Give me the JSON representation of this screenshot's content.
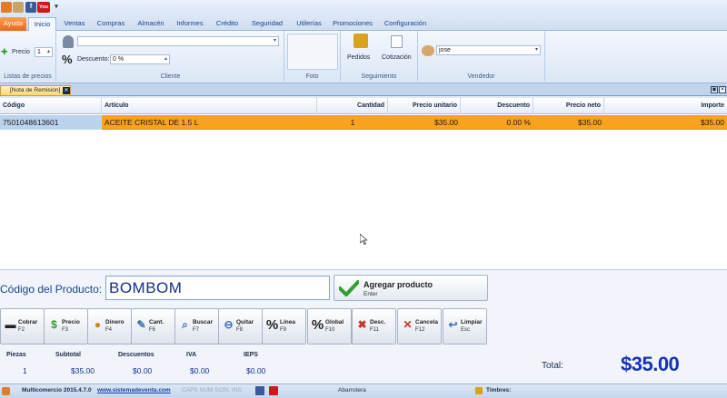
{
  "quick_access": {
    "icons": [
      "app-icon",
      "user-icon",
      "facebook-icon",
      "youtube-icon",
      "dropdown-icon"
    ],
    "facebook_glyph": "f",
    "youtube_glyph": "You",
    "dropdown_glyph": "▾"
  },
  "tabs": [
    "Ayuda",
    "Inicio",
    "Ventas",
    "Compras",
    "Almacén",
    "Informes",
    "Crédito",
    "Seguridad",
    "Utilerías",
    "Promociones",
    "Configuración"
  ],
  "ribbon": {
    "price_list": {
      "label": "Precio",
      "value": "1",
      "group": "Listas de precios"
    },
    "client": {
      "client_value": "",
      "discount_label": "Descuento:",
      "discount_value": "0 %",
      "group": "Cliente"
    },
    "photo": {
      "group": "Foto"
    },
    "tracking": {
      "orders_label": "Pedidos",
      "quote_label": "Cotización",
      "group": "Seguimiento"
    },
    "seller": {
      "value": "jose",
      "group": "Vendedor"
    }
  },
  "document_tab": {
    "title": "[Nota de Remisión]",
    "close_glyph": "✕"
  },
  "window_controls": {
    "restore": "▣",
    "close": "✕"
  },
  "grid": {
    "headers": [
      "Código",
      "Artículo",
      "Cantidad",
      "Precio unitario",
      "Descuento",
      "Precio neto",
      "Importe"
    ],
    "rows": [
      [
        "7501048613601",
        "ACEITE CRISTAL DE 1.5 L",
        "1",
        "$35.00",
        "0.00 %",
        "$35.00",
        "$35.00"
      ]
    ]
  },
  "product_entry": {
    "label": "Código del Producto:",
    "value": "BOMBOM",
    "add_button": {
      "label": "Agregar producto",
      "shortcut": "Enter"
    }
  },
  "function_keys": [
    {
      "label": "Cobrar",
      "key": "F2",
      "icon": "register-icon",
      "glyph": "▬",
      "color": "#222222"
    },
    {
      "label": "Precio",
      "key": "F3",
      "icon": "dollar-icon",
      "glyph": "$",
      "color": "#2e9a2e"
    },
    {
      "label": "Dinero",
      "key": "F4",
      "icon": "coins-icon",
      "glyph": "●",
      "color": "#c98b1a"
    },
    {
      "label": "Cant.",
      "key": "F6",
      "icon": "pencil-icon",
      "glyph": "✎",
      "color": "#3a6fb7"
    },
    {
      "label": "Buscar",
      "key": "F7",
      "icon": "magnifier-icon",
      "glyph": "⌕",
      "color": "#3a6fb7"
    },
    {
      "label": "Quitar",
      "key": "F8",
      "icon": "minus-icon",
      "glyph": "⊖",
      "color": "#3a6fb7"
    },
    {
      "label": "Línea",
      "key": "F9",
      "icon": "percent-icon",
      "glyph": "%",
      "color": "#222222"
    },
    {
      "label": "Global",
      "key": "F10",
      "icon": "percent-global-icon",
      "glyph": "%",
      "color": "#222222"
    },
    {
      "label": "Desc.",
      "key": "F11",
      "icon": "remove-discount-icon",
      "glyph": "✖",
      "color": "#c0392b"
    },
    {
      "label": "Cancela",
      "key": "F12",
      "icon": "cancel-icon",
      "glyph": "✕",
      "color": "#c0392b"
    },
    {
      "label": "Limpiar",
      "key": "Esc",
      "icon": "undo-icon",
      "glyph": "↩",
      "color": "#3a6fb7"
    }
  ],
  "totals": {
    "pieces": {
      "label": "Piezas",
      "value": "1"
    },
    "subtotal": {
      "label": "Subtotal",
      "value": "$35.00"
    },
    "discounts": {
      "label": "Descuentos",
      "value": "$0.00"
    },
    "iva": {
      "label": "IVA",
      "value": "$0.00"
    },
    "ieps": {
      "label": "IEPS",
      "value": "$0.00"
    },
    "total_label": "Total:",
    "total_value": "$35.00"
  },
  "status_bar": {
    "version": "Multicomercio 2015.4.7.0",
    "website": "www.sistemadeventa.com",
    "status_keys": "CAPS  NUM  SCRL  INS",
    "store_type": "Abarrotera",
    "stamps": "Timbres:"
  },
  "colors": {
    "accent": "#15428b",
    "selected_row": "#f9a21e",
    "total": "#1632b8",
    "ayuda_tab": "#e9691f"
  }
}
